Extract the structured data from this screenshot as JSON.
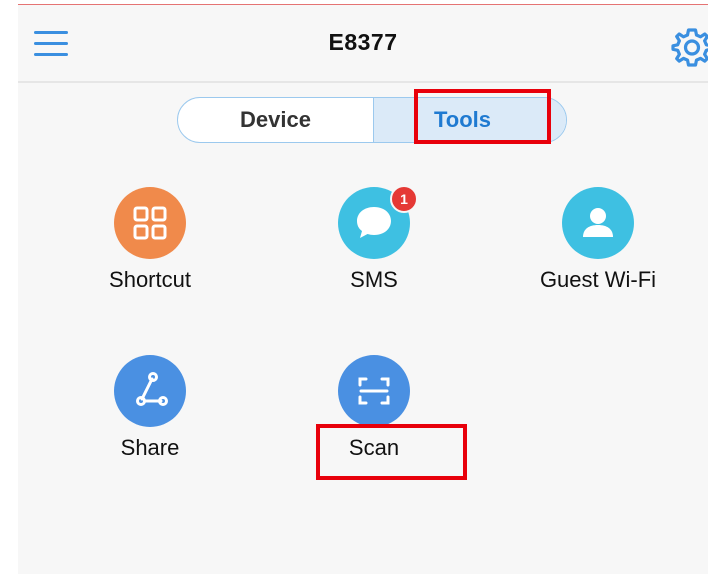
{
  "header": {
    "title": "E8377",
    "menu_icon": "hamburger-menu-icon",
    "settings_icon": "gear-icon"
  },
  "segment": {
    "tabs": [
      {
        "label": "Device",
        "selected": false
      },
      {
        "label": "Tools",
        "selected": true
      }
    ]
  },
  "tools": [
    {
      "label": "Shortcut",
      "icon": "grid-icon",
      "color": "#f08a4b"
    },
    {
      "label": "SMS",
      "icon": "chat-bubble-icon",
      "color": "#3ec0e2",
      "badge": "1"
    },
    {
      "label": "Guest Wi-Fi",
      "icon": "person-icon",
      "color": "#3ec0e2"
    },
    {
      "label": "Share",
      "icon": "share-icon",
      "color": "#4a90e2"
    },
    {
      "label": "Scan",
      "icon": "scan-icon",
      "color": "#4a90e2"
    }
  ],
  "colors": {
    "accent": "#1f7ad1",
    "highlight": "#e8000b",
    "badge": "#e53935"
  }
}
